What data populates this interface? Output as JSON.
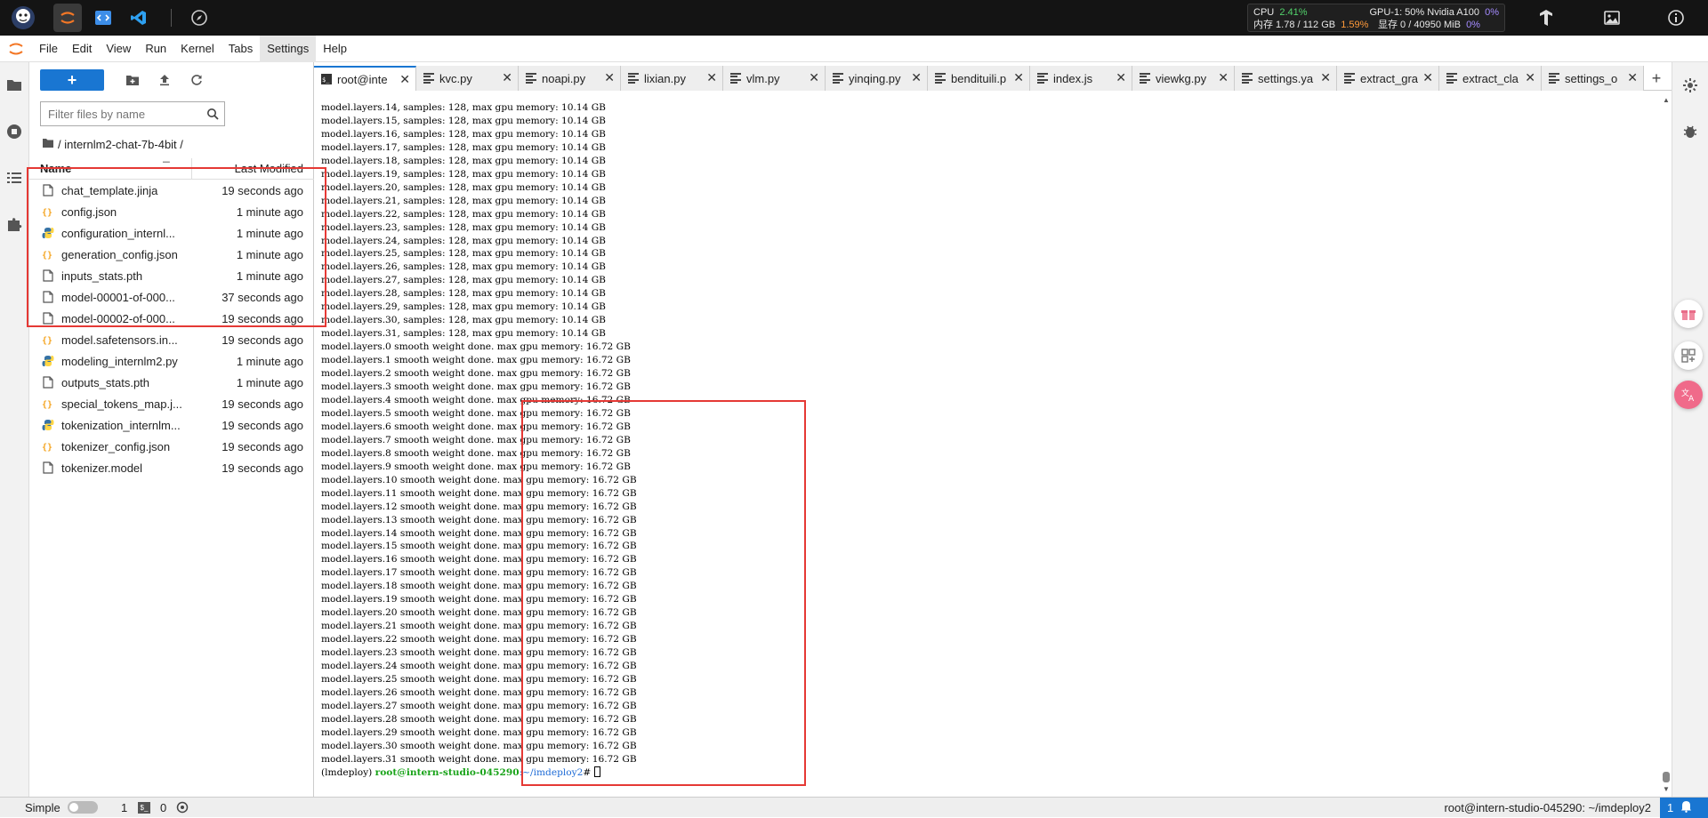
{
  "system_bar": {
    "cpu_label": "CPU",
    "cpu_value": "2.41%",
    "gpu_label": "GPU-1: 50% Nvidia A100",
    "gpu_value": "0%",
    "mem_label": "内存 1.78 / 112 GB",
    "mem_value": "1.59%",
    "vram_label": "显存 0 / 40950 MiB",
    "vram_value": "0%"
  },
  "menu": [
    "File",
    "Edit",
    "View",
    "Run",
    "Kernel",
    "Tabs",
    "Settings",
    "Help"
  ],
  "filebrowser": {
    "new_button": "+",
    "filter_placeholder": "Filter files by name",
    "breadcrumb": "/ internlm2-chat-7b-4bit /",
    "col_name": "Name",
    "col_modified": "Last Modified",
    "files": [
      {
        "name": "chat_template.jinja",
        "modified": "19 seconds ago",
        "type": "file"
      },
      {
        "name": "config.json",
        "modified": "1 minute ago",
        "type": "json"
      },
      {
        "name": "configuration_internl...",
        "modified": "1 minute ago",
        "type": "python"
      },
      {
        "name": "generation_config.json",
        "modified": "1 minute ago",
        "type": "json"
      },
      {
        "name": "inputs_stats.pth",
        "modified": "1 minute ago",
        "type": "file"
      },
      {
        "name": "model-00001-of-000...",
        "modified": "37 seconds ago",
        "type": "file"
      },
      {
        "name": "model-00002-of-000...",
        "modified": "19 seconds ago",
        "type": "file"
      },
      {
        "name": "model.safetensors.in...",
        "modified": "19 seconds ago",
        "type": "json"
      },
      {
        "name": "modeling_internlm2.py",
        "modified": "1 minute ago",
        "type": "python"
      },
      {
        "name": "outputs_stats.pth",
        "modified": "1 minute ago",
        "type": "file"
      },
      {
        "name": "special_tokens_map.j...",
        "modified": "19 seconds ago",
        "type": "json"
      },
      {
        "name": "tokenization_internlm...",
        "modified": "19 seconds ago",
        "type": "python"
      },
      {
        "name": "tokenizer_config.json",
        "modified": "19 seconds ago",
        "type": "json"
      },
      {
        "name": "tokenizer.model",
        "modified": "19 seconds ago",
        "type": "file"
      }
    ]
  },
  "tabs": [
    {
      "label": "root@inte",
      "kind": "terminal",
      "active": true
    },
    {
      "label": "kvc.py",
      "kind": "text"
    },
    {
      "label": "noapi.py",
      "kind": "text"
    },
    {
      "label": "lixian.py",
      "kind": "text"
    },
    {
      "label": "vlm.py",
      "kind": "text"
    },
    {
      "label": "yinqing.py",
      "kind": "text"
    },
    {
      "label": "bendituili.p",
      "kind": "text"
    },
    {
      "label": "index.js",
      "kind": "text"
    },
    {
      "label": "viewkg.py",
      "kind": "text"
    },
    {
      "label": "settings.ya",
      "kind": "text"
    },
    {
      "label": "extract_gra",
      "kind": "text"
    },
    {
      "label": "extract_cla",
      "kind": "text"
    },
    {
      "label": "settings_o",
      "kind": "text"
    }
  ],
  "tab_add": "+",
  "terminal": {
    "lines": [
      "model.layers.14, samples: 128, max gpu memory: 10.14 GB",
      "model.layers.15, samples: 128, max gpu memory: 10.14 GB",
      "model.layers.16, samples: 128, max gpu memory: 10.14 GB",
      "model.layers.17, samples: 128, max gpu memory: 10.14 GB",
      "model.layers.18, samples: 128, max gpu memory: 10.14 GB",
      "model.layers.19, samples: 128, max gpu memory: 10.14 GB",
      "model.layers.20, samples: 128, max gpu memory: 10.14 GB",
      "model.layers.21, samples: 128, max gpu memory: 10.14 GB",
      "model.layers.22, samples: 128, max gpu memory: 10.14 GB",
      "model.layers.23, samples: 128, max gpu memory: 10.14 GB",
      "model.layers.24, samples: 128, max gpu memory: 10.14 GB",
      "model.layers.25, samples: 128, max gpu memory: 10.14 GB",
      "model.layers.26, samples: 128, max gpu memory: 10.14 GB",
      "model.layers.27, samples: 128, max gpu memory: 10.14 GB",
      "model.layers.28, samples: 128, max gpu memory: 10.14 GB",
      "model.layers.29, samples: 128, max gpu memory: 10.14 GB",
      "model.layers.30, samples: 128, max gpu memory: 10.14 GB",
      "model.layers.31, samples: 128, max gpu memory: 10.14 GB",
      "model.layers.0 smooth weight done. max gpu memory: 16.72 GB",
      "model.layers.1 smooth weight done. max gpu memory: 16.72 GB",
      "model.layers.2 smooth weight done. max gpu memory: 16.72 GB",
      "model.layers.3 smooth weight done. max gpu memory: 16.72 GB",
      "model.layers.4 smooth weight done. max gpu memory: 16.72 GB",
      "model.layers.5 smooth weight done. max gpu memory: 16.72 GB",
      "model.layers.6 smooth weight done. max gpu memory: 16.72 GB",
      "model.layers.7 smooth weight done. max gpu memory: 16.72 GB",
      "model.layers.8 smooth weight done. max gpu memory: 16.72 GB",
      "model.layers.9 smooth weight done. max gpu memory: 16.72 GB",
      "model.layers.10 smooth weight done. max gpu memory: 16.72 GB",
      "model.layers.11 smooth weight done. max gpu memory: 16.72 GB",
      "model.layers.12 smooth weight done. max gpu memory: 16.72 GB",
      "model.layers.13 smooth weight done. max gpu memory: 16.72 GB",
      "model.layers.14 smooth weight done. max gpu memory: 16.72 GB",
      "model.layers.15 smooth weight done. max gpu memory: 16.72 GB",
      "model.layers.16 smooth weight done. max gpu memory: 16.72 GB",
      "model.layers.17 smooth weight done. max gpu memory: 16.72 GB",
      "model.layers.18 smooth weight done. max gpu memory: 16.72 GB",
      "model.layers.19 smooth weight done. max gpu memory: 16.72 GB",
      "model.layers.20 smooth weight done. max gpu memory: 16.72 GB",
      "model.layers.21 smooth weight done. max gpu memory: 16.72 GB",
      "model.layers.22 smooth weight done. max gpu memory: 16.72 GB",
      "model.layers.23 smooth weight done. max gpu memory: 16.72 GB",
      "model.layers.24 smooth weight done. max gpu memory: 16.72 GB",
      "model.layers.25 smooth weight done. max gpu memory: 16.72 GB",
      "model.layers.26 smooth weight done. max gpu memory: 16.72 GB",
      "model.layers.27 smooth weight done. max gpu memory: 16.72 GB",
      "model.layers.28 smooth weight done. max gpu memory: 16.72 GB",
      "model.layers.29 smooth weight done. max gpu memory: 16.72 GB",
      "model.layers.30 smooth weight done. max gpu memory: 16.72 GB",
      "model.layers.31 smooth weight done. max gpu memory: 16.72 GB"
    ],
    "prompt_env": "(lmdeploy) ",
    "prompt_user": "root@intern-studio-045290",
    "prompt_path": ":~/imdeploy2",
    "prompt_suffix": "# "
  },
  "statusbar": {
    "mode": "Simple",
    "kernels": "1",
    "terminals": "0",
    "path": "root@intern-studio-045290: ~/imdeploy2",
    "notifications": "1"
  },
  "colors": {
    "accent": "#1976d2",
    "annotation": "#e53935",
    "prompt_user": "#19a319",
    "prompt_path": "#1e6bd6"
  }
}
